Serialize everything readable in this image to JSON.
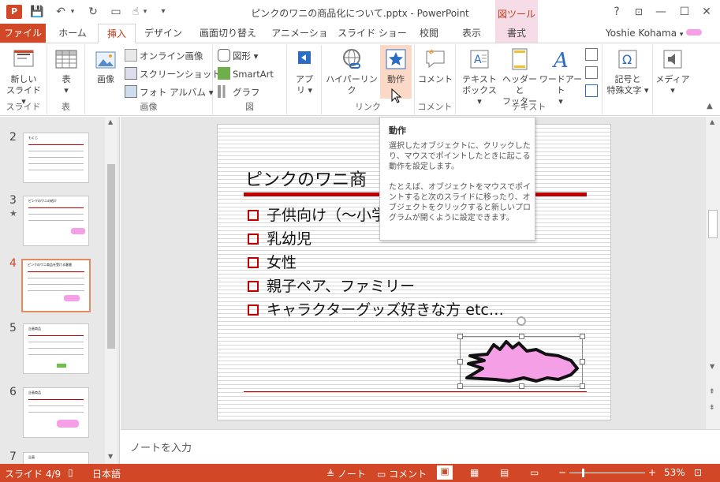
{
  "window": {
    "title": "ピンクのワニの商品化について.pptx - PowerPoint",
    "context_tab_group": "図ツール",
    "help": "?"
  },
  "tabs": [
    "ファイル",
    "ホーム",
    "挿入",
    "デザイン",
    "画面切り替え",
    "アニメーション",
    "スライド ショー",
    "校閲",
    "表示",
    "書式"
  ],
  "active_tab": "挿入",
  "user": "Yoshie Kohama",
  "ribbon": {
    "slides_group": {
      "label": "スライド",
      "new_slide": "新しい",
      "new_slide2": "スライド"
    },
    "table_group": {
      "label": "表",
      "table": "表"
    },
    "images_group": {
      "label": "画像",
      "picture": "画像",
      "online": "オンライン画像",
      "screenshot": "スクリーンショット",
      "album": "フォト アルバム"
    },
    "illustrations_group": {
      "label": "図",
      "shapes": "図形",
      "smartart": "SmartArt",
      "chart": "グラフ"
    },
    "apps_group": {
      "apps": "アプ",
      "apps2": "リ"
    },
    "links_group": {
      "label": "リンク",
      "hyperlink": "ハイパーリンク",
      "action": "動作"
    },
    "comments_group": {
      "label": "コメント",
      "comment": "コメント"
    },
    "text_group": {
      "label": "テキスト",
      "textbox": "テキスト",
      "textbox2": "ボックス",
      "header": "ヘッダーと",
      "header2": "フッター",
      "wordart": "ワードアート"
    },
    "symbols_group": {
      "symbols": "記号と",
      "symbols2": "特殊文字"
    },
    "media_group": {
      "media": "メディア"
    }
  },
  "tooltip": {
    "title": "動作",
    "line1": "選択したオブジェクトに、クリックしたり、マウスでポイントしたときに起こる動作を設定します。",
    "line2": "たとえば、オブジェクトをマウスでポイントすると次のスライドに移ったり、オブジェクトをクリックすると新しいプログラムが開くように設定できます。"
  },
  "thumbnails": [
    {
      "num": "2",
      "title": "もくじ"
    },
    {
      "num": "3",
      "title": "ピンクのワニの紹介"
    },
    {
      "num": "4",
      "title": "ピンクのワニ商品を受ける客層"
    },
    {
      "num": "5",
      "title": "企画商品"
    },
    {
      "num": "6",
      "title": "企画商品"
    },
    {
      "num": "7",
      "title": "企画"
    }
  ],
  "slide": {
    "title": "ピンクのワニ商",
    "bullets": [
      "子供向け（〜小学",
      "乳幼児",
      "女性",
      "親子ペア、ファミリー",
      "キャラクターグッズ好きな方 etc…"
    ]
  },
  "notes_placeholder": "ノートを入力",
  "status": {
    "slide": "スライド 4/9",
    "language": "日本語",
    "notes": "ノート",
    "comments": "コメント",
    "zoom": "53%"
  },
  "colors": {
    "accent": "#d24726",
    "title_bar": "#c00000",
    "croc": "#f5a0e6"
  }
}
